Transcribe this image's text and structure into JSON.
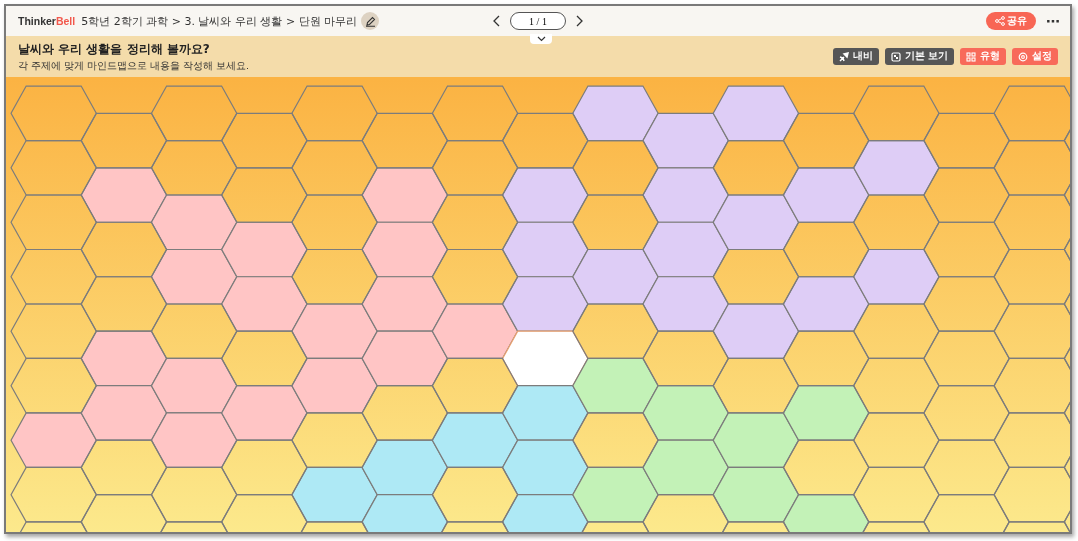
{
  "header": {
    "logo_dark": "Thinker",
    "logo_accent": "Bell",
    "breadcrumb": "5학년 2학기 과학 > 3. 날씨와 우리 생활 > 단원 마무리",
    "page": "1 / 1",
    "share": "공유",
    "more": "⋯"
  },
  "banner": {
    "title": "날씨와 우리 생활을 정리해 볼까요?",
    "subtitle": "각 주제에 맞게 마인드맵으로 내용을 작성해 보세요.",
    "buttons": [
      {
        "label": "내비",
        "kind": "navi"
      },
      {
        "label": "기본 보기",
        "kind": "view"
      },
      {
        "label": "유형",
        "kind": "type"
      },
      {
        "label": "설정",
        "kind": "settings"
      }
    ]
  },
  "mindmap": {
    "columns": [
      {
        "cells": [
          {
            "kind": "plain"
          },
          {
            "kind": "plain"
          },
          {
            "kind": "plain"
          },
          {
            "kind": "plain"
          },
          {
            "kind": "plain"
          },
          {
            "kind": "plain"
          },
          {
            "kind": "pink"
          },
          {
            "kind": "plain"
          },
          {
            "kind": "plain"
          }
        ]
      },
      {
        "cells": [
          {
            "kind": "plain"
          },
          {
            "kind": "pink"
          },
          {
            "kind": "plain"
          },
          {
            "kind": "plain"
          },
          {
            "kind": "pink"
          },
          {
            "kind": "pink"
          },
          {
            "kind": "plain"
          },
          {
            "kind": "plain"
          }
        ]
      },
      {
        "cells": [
          {
            "kind": "plain"
          },
          {
            "kind": "plain"
          },
          {
            "kind": "pink"
          },
          {
            "kind": "pink"
          },
          {
            "kind": "plain"
          },
          {
            "kind": "pink"
          },
          {
            "kind": "pink"
          },
          {
            "kind": "plain"
          },
          {
            "kind": "plain"
          }
        ]
      },
      {
        "cells": [
          {
            "kind": "plain"
          },
          {
            "kind": "plain"
          },
          {
            "kind": "pink"
          },
          {
            "kind": "pink"
          },
          {
            "kind": "plain"
          },
          {
            "kind": "pink"
          },
          {
            "kind": "plain"
          },
          {
            "kind": "plain"
          }
        ]
      },
      {
        "cells": [
          {
            "kind": "plain"
          },
          {
            "kind": "plain"
          },
          {
            "kind": "plain"
          },
          {
            "kind": "plain"
          },
          {
            "kind": "pink"
          },
          {
            "kind": "pink"
          },
          {
            "kind": "plain"
          },
          {
            "kind": "blue"
          },
          {
            "kind": "plain"
          }
        ]
      },
      {
        "cells": [
          {
            "kind": "plain"
          },
          {
            "kind": "pink"
          },
          {
            "kind": "pink"
          },
          {
            "kind": "pink"
          },
          {
            "kind": "pink"
          },
          {
            "kind": "plain"
          },
          {
            "kind": "blue"
          },
          {
            "kind": "blue"
          }
        ]
      },
      {
        "cells": [
          {
            "kind": "plain"
          },
          {
            "kind": "plain"
          },
          {
            "kind": "plain"
          },
          {
            "kind": "plain"
          },
          {
            "kind": "pink"
          },
          {
            "kind": "plain"
          },
          {
            "kind": "blue"
          },
          {
            "kind": "plain"
          },
          {
            "kind": "plain"
          }
        ]
      },
      {
        "cells": [
          {
            "kind": "plain"
          },
          {
            "kind": "violet"
          },
          {
            "kind": "violet"
          },
          {
            "kind": "violet"
          },
          {
            "kind": "center"
          },
          {
            "kind": "blue"
          },
          {
            "kind": "blue"
          },
          {
            "kind": "blue"
          }
        ]
      },
      {
        "cells": [
          {
            "kind": "violet"
          },
          {
            "kind": "plain"
          },
          {
            "kind": "plain"
          },
          {
            "kind": "violet"
          },
          {
            "kind": "plain"
          },
          {
            "kind": "green"
          },
          {
            "kind": "plain"
          },
          {
            "kind": "green"
          },
          {
            "kind": "plain"
          }
        ]
      },
      {
        "cells": [
          {
            "kind": "violet"
          },
          {
            "kind": "violet"
          },
          {
            "kind": "violet"
          },
          {
            "kind": "violet"
          },
          {
            "kind": "plain"
          },
          {
            "kind": "green"
          },
          {
            "kind": "green"
          },
          {
            "kind": "plain"
          }
        ]
      },
      {
        "cells": [
          {
            "kind": "violet"
          },
          {
            "kind": "plain"
          },
          {
            "kind": "violet"
          },
          {
            "kind": "plain"
          },
          {
            "kind": "violet"
          },
          {
            "kind": "plain"
          },
          {
            "kind": "green"
          },
          {
            "kind": "green"
          },
          {
            "kind": "plain"
          }
        ]
      },
      {
        "cells": [
          {
            "kind": "plain"
          },
          {
            "kind": "violet"
          },
          {
            "kind": "plain"
          },
          {
            "kind": "violet"
          },
          {
            "kind": "plain"
          },
          {
            "kind": "green"
          },
          {
            "kind": "plain"
          },
          {
            "kind": "green"
          }
        ]
      },
      {
        "cells": [
          {
            "kind": "plain"
          },
          {
            "kind": "violet"
          },
          {
            "kind": "plain"
          },
          {
            "kind": "violet"
          },
          {
            "kind": "plain"
          },
          {
            "kind": "plain"
          },
          {
            "kind": "plain"
          },
          {
            "kind": "plain"
          },
          {
            "kind": "plain"
          }
        ]
      },
      {
        "cells": [
          {
            "kind": "plain"
          },
          {
            "kind": "plain"
          },
          {
            "kind": "plain"
          },
          {
            "kind": "plain"
          },
          {
            "kind": "plain"
          },
          {
            "kind": "plain"
          },
          {
            "kind": "plain"
          },
          {
            "kind": "plain"
          }
        ]
      },
      {
        "cells": [
          {
            "kind": "plain"
          },
          {
            "kind": "plain"
          },
          {
            "kind": "plain"
          },
          {
            "kind": "plain"
          },
          {
            "kind": "plain"
          },
          {
            "kind": "plain"
          },
          {
            "kind": "plain"
          },
          {
            "kind": "plain"
          },
          {
            "kind": "plain"
          }
        ]
      },
      {
        "cells": [
          {
            "kind": "plain"
          },
          {
            "kind": "plain"
          },
          {
            "kind": "plain"
          },
          {
            "kind": "plain"
          },
          {
            "kind": "plain"
          },
          {
            "kind": "plain"
          },
          {
            "kind": "plain"
          },
          {
            "kind": "plain"
          }
        ]
      }
    ]
  }
}
